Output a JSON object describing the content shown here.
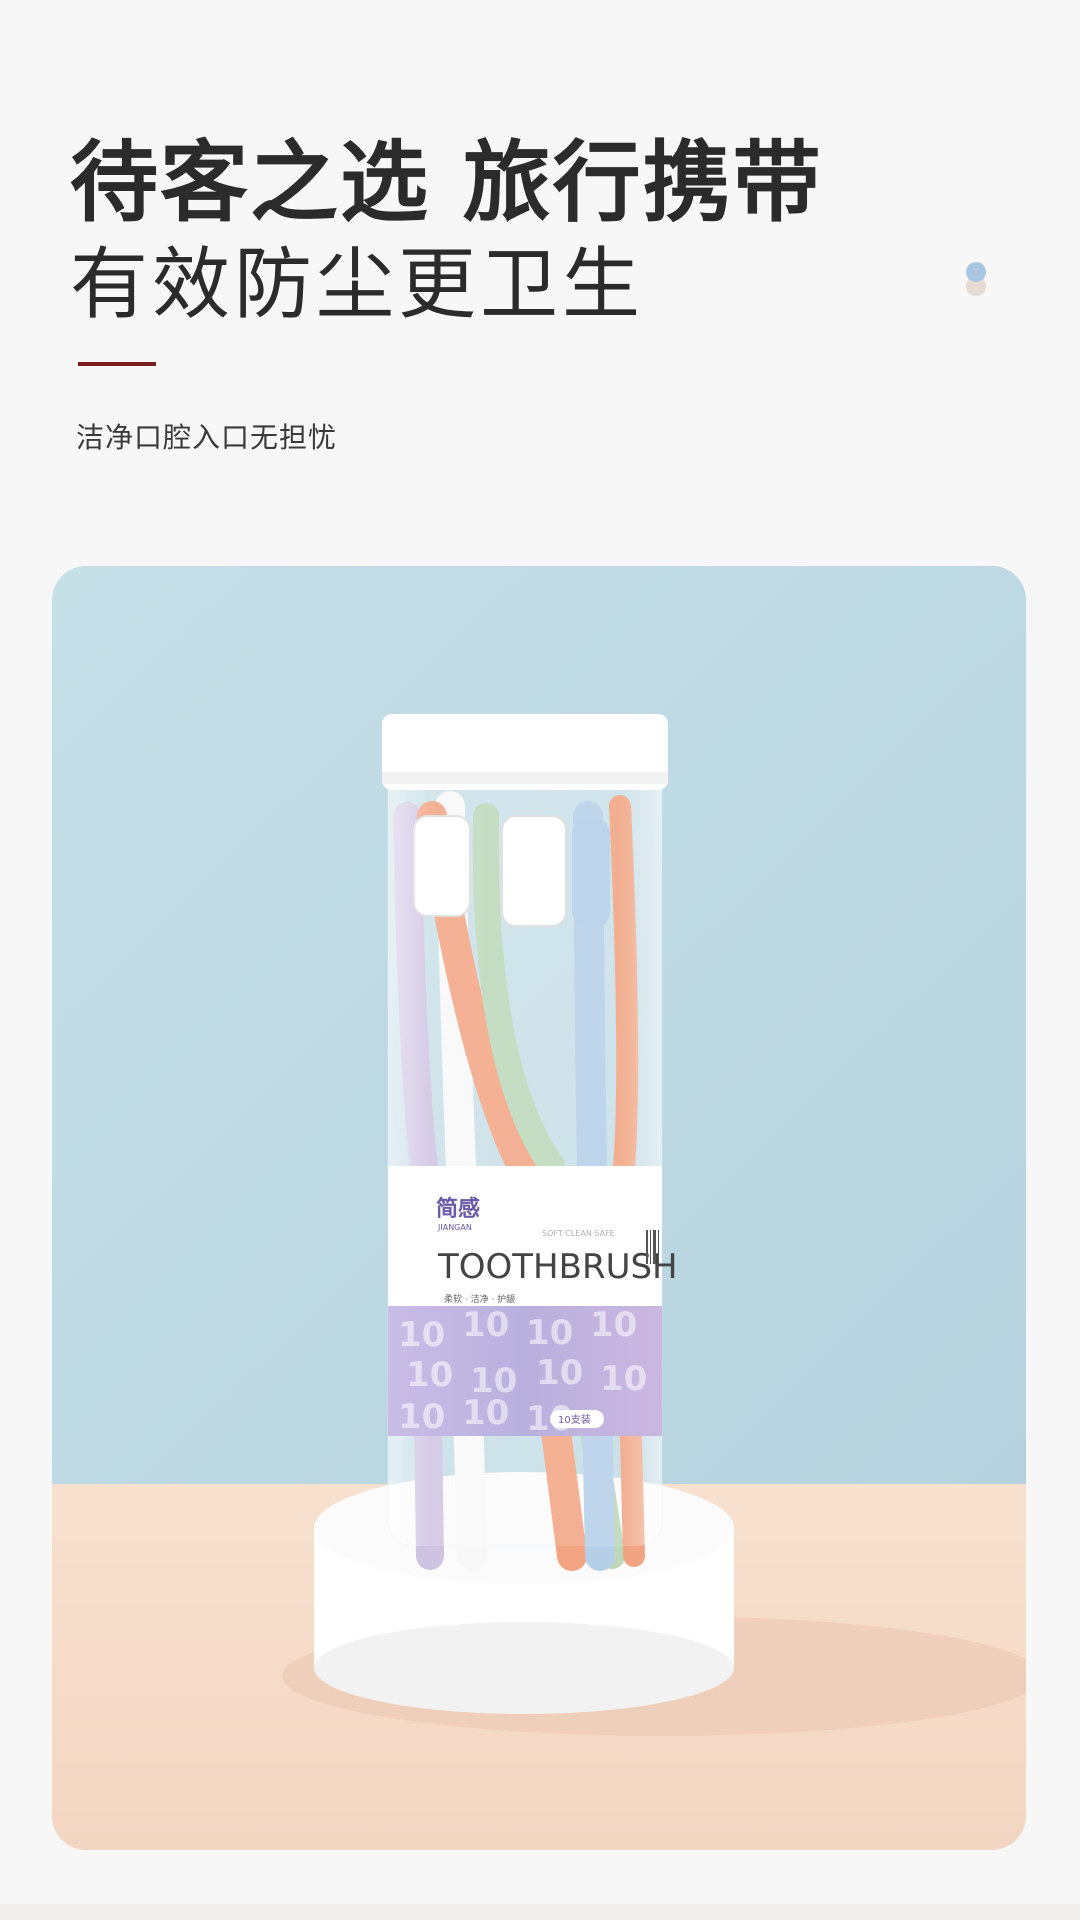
{
  "headline": {
    "line1": "待客之选 旅行携带",
    "line2": "有效防尘更卫生",
    "subtitle": "洁净口腔入口无担忧"
  },
  "colors": {
    "accent_line": "#7a2020",
    "dot_blue": "#a9c7e3",
    "dot_beige": "#e6dcd3",
    "backdrop_wall": "#bcd9e3",
    "table_surface": "#f6dccb",
    "pedestal": "#ffffff"
  },
  "product": {
    "brand_cn": "简感",
    "brand_en": "JIANGAN",
    "tagline": "SOFT·CLEAN·SAFE",
    "name": "TOOTHBRUSH",
    "features": "柔软 · 洁净 · 护龈",
    "pack_count": "10支装",
    "pattern_text": "10"
  },
  "icons": {
    "decor_dots": "two-dot-decoration-icon"
  }
}
